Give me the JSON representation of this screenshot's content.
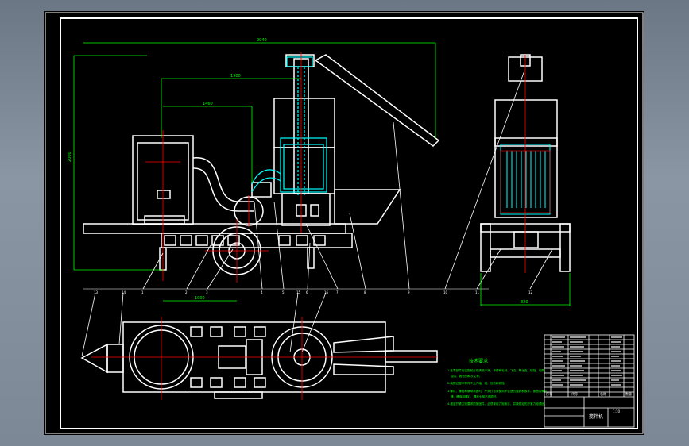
{
  "drawing": {
    "dimensions": {
      "overall_length": "2940",
      "upper_span": "1900",
      "mid_span": "1460",
      "height": "2000",
      "lower_span": "1000",
      "side_width": "820"
    },
    "callouts": [
      "1",
      "2",
      "3",
      "4",
      "5",
      "6",
      "7",
      "8",
      "9",
      "10",
      "11",
      "12",
      "13",
      "14",
      "15",
      "16"
    ],
    "tech_requirements": {
      "title": "技术要求",
      "lines": [
        "1.各零部件在装配前必须清洗干净，不得有毛刺、飞边、氧化皮、锈蚀、切屑、",
        "油污、着色剂和灰尘等。",
        "2.装配过程中零件不允许磕、碰、划伤和锈蚀。",
        "3.螺钉、螺栓和螺母紧固时，严禁打击或使用不合适的旋具和扳手。紧固后螺钉",
        "槽、螺母和螺钉、螺栓头部不得损坏。",
        "4.规定拧紧力矩要求的紧固件，必须采用力矩扳手，并按规定的拧紧力矩紧固。"
      ]
    },
    "title_block": {
      "header_cells": [
        "序号",
        "代号",
        "名称",
        "数量"
      ],
      "drawing_name": "搅拌机",
      "scale": "1:10"
    },
    "colors": {
      "background": "#000000",
      "lines": "#ffffff",
      "dimension": "#00ff00",
      "hidden": "#00ffff",
      "centerline": "#ff0000"
    }
  }
}
